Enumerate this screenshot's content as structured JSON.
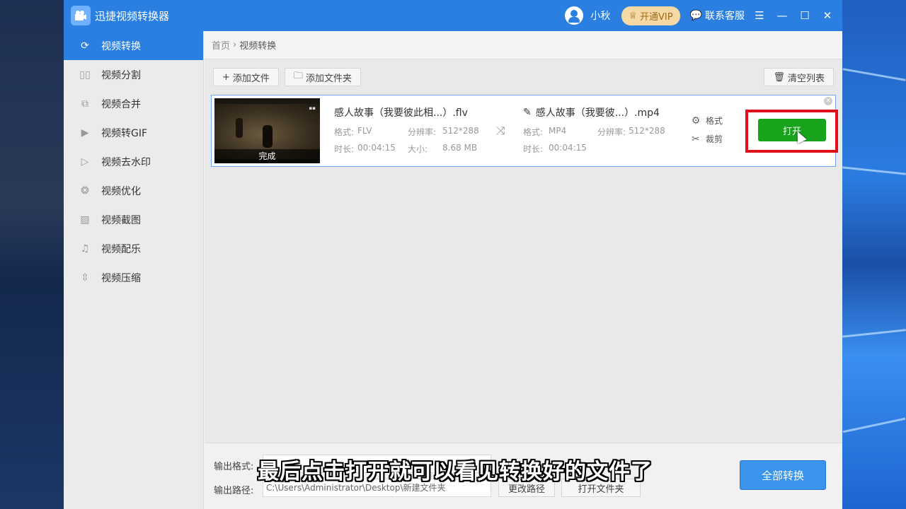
{
  "app": {
    "title": "迅捷视频转换器"
  },
  "header": {
    "username": "小秋",
    "vip_label": "开通VIP",
    "service_label": "联系客服"
  },
  "sidebar": {
    "items": [
      {
        "label": "视频转换",
        "icon": "convert-icon",
        "active": true
      },
      {
        "label": "视频分割",
        "icon": "split-icon"
      },
      {
        "label": "视频合并",
        "icon": "merge-icon"
      },
      {
        "label": "视频转GIF",
        "icon": "gif-icon"
      },
      {
        "label": "视频去水印",
        "icon": "watermark-icon"
      },
      {
        "label": "视频优化",
        "icon": "optimize-icon"
      },
      {
        "label": "视频截图",
        "icon": "screenshot-icon"
      },
      {
        "label": "视频配乐",
        "icon": "music-icon"
      },
      {
        "label": "视频压缩",
        "icon": "compress-icon"
      }
    ]
  },
  "breadcrumb": {
    "home": "首页",
    "separator": "›",
    "current": "视频转换"
  },
  "toolbar": {
    "add_file": "添加文件",
    "add_folder": "添加文件夹",
    "clear_list": "清空列表"
  },
  "file": {
    "status": "完成",
    "source": {
      "name": "感人故事（我要彼此相...）.flv",
      "format_label": "格式:",
      "format": "FLV",
      "resolution_label": "分辨率:",
      "resolution": "512*288",
      "duration_label": "时长:",
      "duration": "00:04:15",
      "size_label": "大小:",
      "size": "8.68 MB"
    },
    "output": {
      "name": "感人故事（我要彼...）.mp4",
      "format_label": "格式:",
      "format": "MP4",
      "resolution_label": "分辨率:",
      "resolution": "512*288",
      "duration_label": "时长:",
      "duration": "00:04:15"
    },
    "format_action": "格式",
    "crop_action": "裁剪",
    "open_button": "打开"
  },
  "bottom": {
    "output_format_label": "输出格式:",
    "output_path_label": "输出路径:",
    "output_path": "C:\\Users\\Administrator\\Desktop\\新建文件夹",
    "change_path": "更改路径",
    "open_folder": "打开文件夹",
    "convert_all": "全部转换"
  },
  "caption": "最后点击打开就可以看见转换好的文件了",
  "colors": {
    "accent": "#2b7fe0",
    "open_button": "#17a31b",
    "highlight_box": "#e0101b"
  }
}
